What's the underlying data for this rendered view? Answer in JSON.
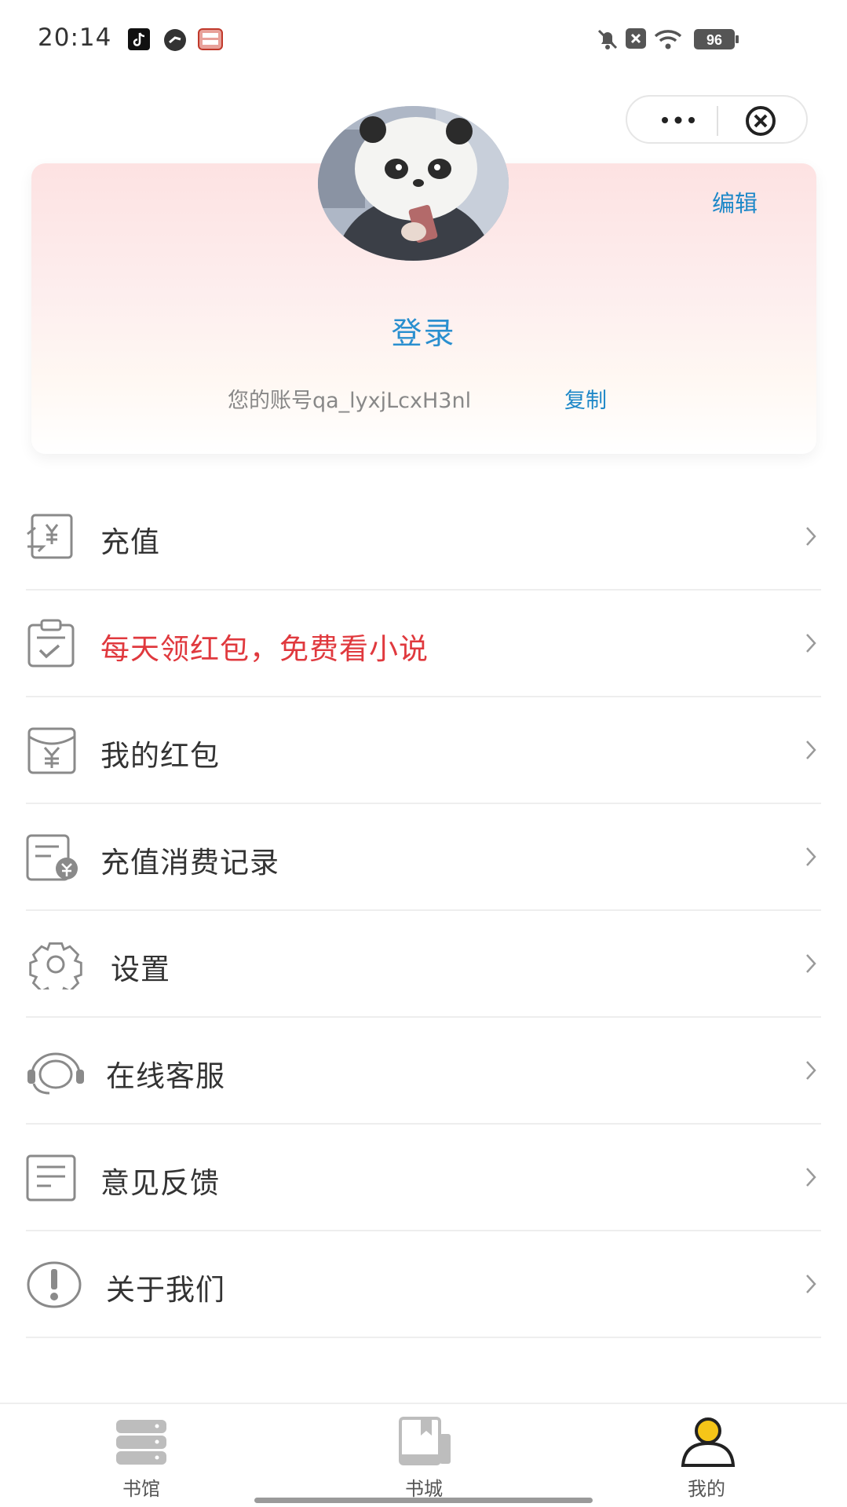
{
  "status_bar": {
    "time": "20:14",
    "battery": "96",
    "icons": [
      "tiktok-icon",
      "app-icon",
      "store-icon",
      "mute-icon",
      "close-box-icon",
      "wifi-icon",
      "battery-icon"
    ]
  },
  "capsule": {
    "more_icon": "more-dots-icon",
    "close_icon": "close-circle-icon"
  },
  "profile": {
    "avatar": "panda avatar",
    "edit_label": "编辑",
    "login_label": "登录",
    "account_text": "您的账号qa_lyxjLcxH3nl",
    "copy_label": "复制"
  },
  "menu": {
    "items": [
      {
        "label": "充值",
        "icon": "recharge-icon",
        "highlight": false
      },
      {
        "label": "每天领红包，免费看小说",
        "icon": "clipboard-check-icon",
        "highlight": true
      },
      {
        "label": "我的红包",
        "icon": "red-envelope-icon",
        "highlight": false
      },
      {
        "label": "充值消费记录",
        "icon": "bill-record-icon",
        "highlight": false
      },
      {
        "label": "设置",
        "icon": "gear-icon",
        "highlight": false
      },
      {
        "label": "在线客服",
        "icon": "headset-icon",
        "highlight": false
      },
      {
        "label": "意见反馈",
        "icon": "feedback-icon",
        "highlight": false
      },
      {
        "label": "关于我们",
        "icon": "info-icon",
        "highlight": false
      }
    ]
  },
  "tabbar": {
    "tabs": [
      {
        "label": "书馆",
        "icon": "bookshelf-icon",
        "active": false
      },
      {
        "label": "书城",
        "icon": "book-icon",
        "active": false
      },
      {
        "label": "我的",
        "icon": "user-icon",
        "active": true
      }
    ]
  },
  "colors": {
    "link": "#1e88c8",
    "highlight": "#e0393e",
    "active_tab": "#f5c518",
    "icon_gray": "#8a8a8a"
  }
}
